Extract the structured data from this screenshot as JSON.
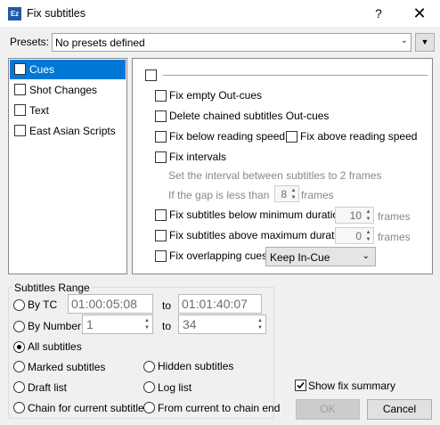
{
  "window": {
    "icon_text": "Ez",
    "title": "Fix subtitles",
    "help_glyph": "?",
    "close_glyph": "✕"
  },
  "presets": {
    "label": "Presets:",
    "value": "No presets defined",
    "dropdown_glyph": "⌄",
    "menu_glyph": "▼"
  },
  "categories": [
    {
      "label": "Cues",
      "checked": false,
      "selected": true
    },
    {
      "label": "Shot Changes",
      "checked": false,
      "selected": false
    },
    {
      "label": "Text",
      "checked": false,
      "selected": false
    },
    {
      "label": "East Asian Scripts",
      "checked": false,
      "selected": false
    }
  ],
  "cues_panel": {
    "fix_empty_out_cues": "Fix empty Out-cues",
    "delete_chained_out_cues": "Delete chained subtitles Out-cues",
    "fix_below_reading_speed": "Fix below reading speed",
    "fix_above_reading_speed": "Fix above reading speed",
    "fix_intervals": "Fix intervals",
    "interval_hint": "Set the interval between subtitles to 2 frames",
    "gap_label": "If the gap is less than",
    "gap_value": "8",
    "gap_unit": "frames",
    "fix_below_min_duration": "Fix subtitles below minimum duration",
    "min_duration_value": "10",
    "min_duration_unit": "frames",
    "fix_above_max_duration": "Fix subtitles above maximum duration",
    "max_duration_value": "0",
    "max_duration_unit": "frames",
    "fix_overlapping_cues": "Fix overlapping cues",
    "overlap_mode": "Keep In-Cue",
    "overlap_glyph": "⌄"
  },
  "range": {
    "title": "Subtitles Range",
    "by_tc": "By TC",
    "tc_from": "01:00:05:08",
    "to_label": "to",
    "tc_to": "01:01:40:07",
    "by_number": "By Number",
    "num_from": "1",
    "num_to": "34",
    "all_subtitles": "All subtitles",
    "marked_subtitles": "Marked subtitles",
    "hidden_subtitles": "Hidden subtitles",
    "draft_list": "Draft list",
    "log_list": "Log list",
    "chain_current": "Chain for current subtitle",
    "current_to_end": "From current to chain end",
    "selected_option": "All subtitles"
  },
  "footer": {
    "show_fix_summary": "Show fix summary",
    "show_fix_summary_checked": true,
    "ok_label": "OK",
    "cancel_label": "Cancel"
  }
}
